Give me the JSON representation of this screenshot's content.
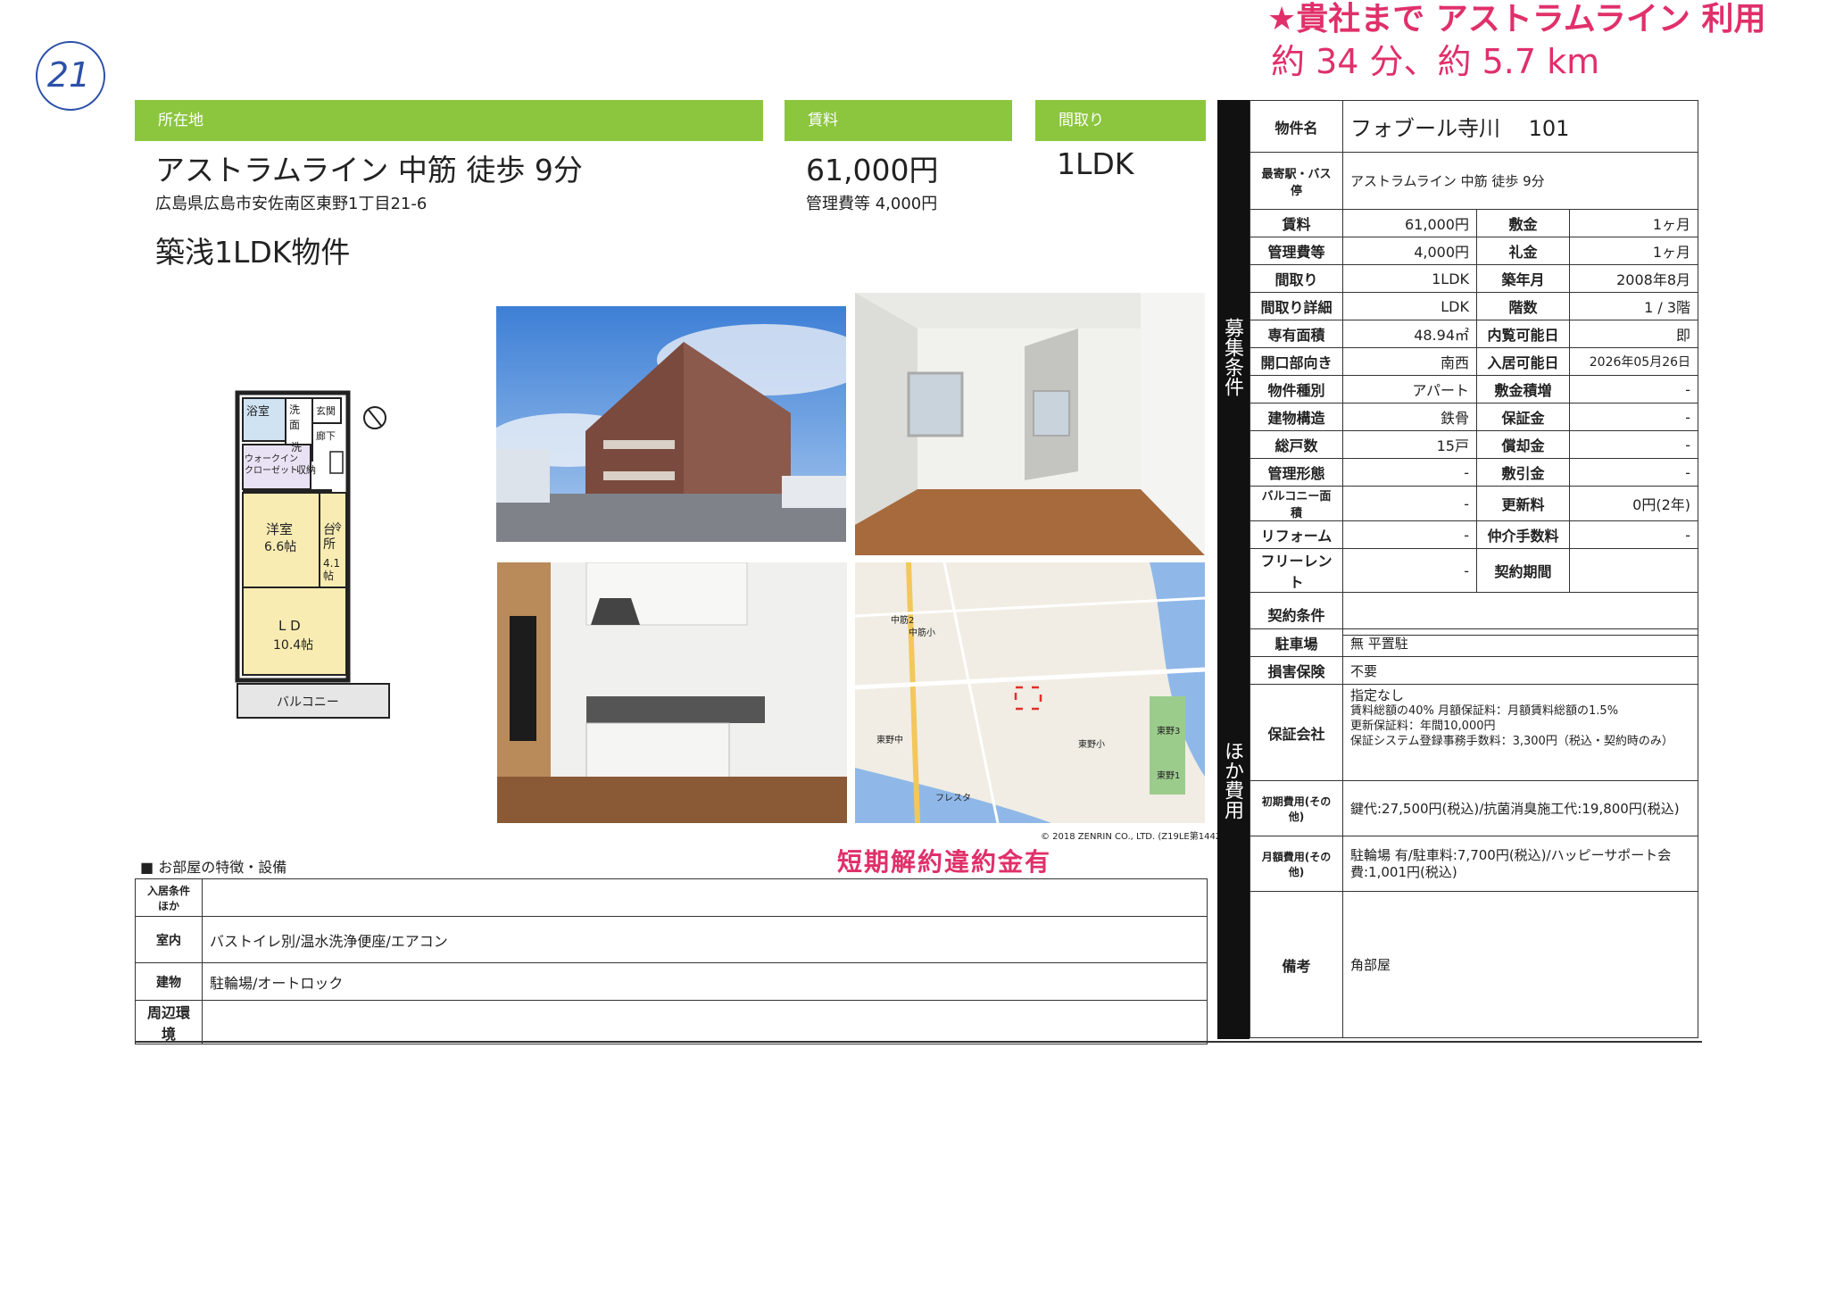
{
  "handwritten": {
    "page_number": "21",
    "line1": "★貴社まで アストラムライン 利用",
    "line2": "約 34 分、約 5.7 km"
  },
  "header": {
    "location_label": "所在地",
    "rent_label": "賃料",
    "layout_label": "間取り",
    "access": "アストラムライン 中筋 徒歩 9分",
    "address": "広島県広島市安佐南区東野1丁目21-6",
    "rent": "61,000円",
    "management_fee": "管理費等 4,000円",
    "layout": "1LDK",
    "catch_copy": "築浅1LDK物件"
  },
  "floorplan": {
    "bath": "浴室",
    "washroom": "洗面",
    "toilet": "洗",
    "entrance": "玄関",
    "hall": "廊下",
    "walkin": "ウォークイン クローゼット",
    "storage": "収納",
    "fridge": "冷",
    "western_room": "洋室",
    "western_size": "6.6帖",
    "kitchen": "台所",
    "kitchen_size": "4.1帖",
    "ld": "L D",
    "ld_size": "10.4帖",
    "balcony": "バルコニー"
  },
  "map": {
    "copyright": "© 2018 ZENRIN CO., LTD. (Z19LE第1442号)",
    "labels": [
      "東野小",
      "中筋小",
      "中筋2",
      "東野中",
      "フレスタ",
      "東野3",
      "東野1"
    ]
  },
  "penalty_note": "短期解約違約金有",
  "features": {
    "section_title": "■ お部屋の特徴・設備",
    "rows": [
      {
        "label": "入居条件ほか",
        "value": ""
      },
      {
        "label": "室内",
        "value": "バストイレ別/温水洗浄便座/エアコン"
      },
      {
        "label": "建物",
        "value": "駐輪場/オートロック"
      },
      {
        "label": "周辺環境",
        "value": ""
      }
    ]
  },
  "spec": {
    "side_label_1": "募集条件",
    "side_label_2": "ほか費用",
    "property_name_label": "物件名",
    "property_name": "フォブール寺川　 101",
    "station_label": "最寄駅・バス停",
    "station": "アストラムライン 中筋 徒歩 9分",
    "rows": [
      {
        "l1": "賃料",
        "v1": "61,000円",
        "l2": "敷金",
        "v2": "1ヶ月"
      },
      {
        "l1": "管理費等",
        "v1": "4,000円",
        "l2": "礼金",
        "v2": "1ヶ月"
      },
      {
        "l1": "間取り",
        "v1": "1LDK",
        "l2": "築年月",
        "v2": "2008年8月"
      },
      {
        "l1": "間取り詳細",
        "v1": "LDK",
        "l2": "階数",
        "v2": "1 / 3階"
      },
      {
        "l1": "専有面積",
        "v1": "48.94㎡",
        "l2": "内覧可能日",
        "v2": "即"
      },
      {
        "l1": "開口部向き",
        "v1": "南西",
        "l2": "入居可能日",
        "v2": "2026年05月26日"
      },
      {
        "l1": "物件種別",
        "v1": "アパート",
        "l2": "敷金積増",
        "v2": "-"
      },
      {
        "l1": "建物構造",
        "v1": "鉄骨",
        "l2": "保証金",
        "v2": "-"
      },
      {
        "l1": "総戸数",
        "v1": "15戸",
        "l2": "償却金",
        "v2": "-"
      },
      {
        "l1": "管理形態",
        "v1": "-",
        "l2": "敷引金",
        "v2": "-"
      },
      {
        "l1": "バルコニー面積",
        "v1": "-",
        "l2": "更新料",
        "v2": "0円(2年)"
      },
      {
        "l1": "リフォーム",
        "v1": "-",
        "l2": "仲介手数料",
        "v2": "-"
      },
      {
        "l1": "フリーレント",
        "v1": "-",
        "l2": "契約期間",
        "v2": ""
      }
    ],
    "contract_label": "契約条件",
    "contract_value": "",
    "parking_label": "駐車場",
    "parking": "無 平置駐",
    "insurance_label": "損害保険",
    "insurance": "不要",
    "guarantor_label": "保証会社",
    "guarantor_lines": [
      "指定なし",
      "賃料総額の40% 月額保証料：月額賃料総額の1.5%",
      "更新保証料：年間10,000円",
      "保証システム登録事務手数料：3,300円（税込・契約時のみ）"
    ],
    "initial_label": "初期費用(その他)",
    "initial": "鍵代:27,500円(税込)/抗菌消臭施工代:19,800円(税込)",
    "monthly_label": "月額費用(その他)",
    "monthly": "駐輪場 有/駐車料:7,700円(税込)/ハッピーサポート会費:1,001円(税込)",
    "remarks_label": "備考",
    "remarks": "角部屋"
  }
}
